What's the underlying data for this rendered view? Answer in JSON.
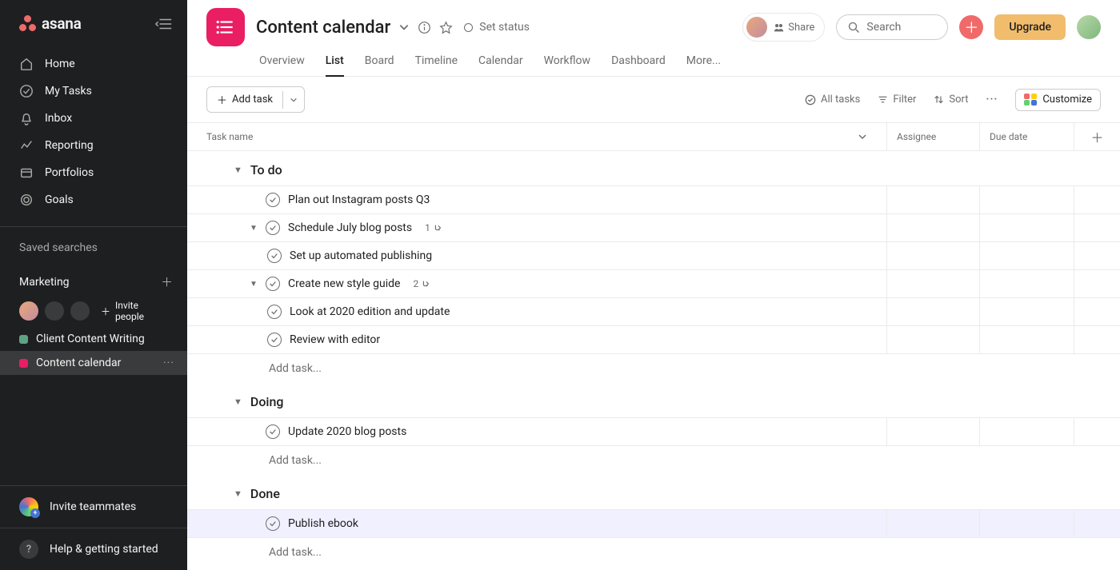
{
  "brand": "asana",
  "sidebar": {
    "nav": [
      {
        "icon": "home",
        "label": "Home"
      },
      {
        "icon": "check",
        "label": "My Tasks"
      },
      {
        "icon": "bell",
        "label": "Inbox"
      },
      {
        "icon": "chart",
        "label": "Reporting"
      },
      {
        "icon": "folder",
        "label": "Portfolios"
      },
      {
        "icon": "target",
        "label": "Goals"
      }
    ],
    "saved_searches_label": "Saved searches",
    "team_name": "Marketing",
    "invite_label": "Invite people",
    "projects": [
      {
        "name": "Client Content Writing",
        "color": "#5da283",
        "active": false
      },
      {
        "name": "Content calendar",
        "color": "#e91e63",
        "active": true
      }
    ],
    "invite_teammates": "Invite teammates",
    "help": "Help & getting started"
  },
  "header": {
    "title": "Content calendar",
    "set_status": "Set status",
    "share": "Share",
    "search_placeholder": "Search",
    "upgrade": "Upgrade"
  },
  "tabs": [
    "Overview",
    "List",
    "Board",
    "Timeline",
    "Calendar",
    "Workflow",
    "Dashboard",
    "More..."
  ],
  "active_tab": "List",
  "toolbar": {
    "add_task": "Add task",
    "all_tasks": "All tasks",
    "filter": "Filter",
    "sort": "Sort",
    "customize": "Customize"
  },
  "columns": {
    "task": "Task name",
    "assignee": "Assignee",
    "due": "Due date"
  },
  "add_task_placeholder": "Add task...",
  "sections": [
    {
      "name": "To do",
      "tasks": [
        {
          "title": "Plan out Instagram posts Q3"
        },
        {
          "title": "Schedule July blog posts",
          "subcount": "1",
          "expanded": true,
          "subtasks": [
            {
              "title": "Set up automated publishing"
            }
          ]
        },
        {
          "title": "Create new style guide",
          "subcount": "2",
          "expanded": true,
          "subtasks": [
            {
              "title": "Look at 2020 edition and update"
            },
            {
              "title": "Review with editor"
            }
          ]
        }
      ],
      "show_add": true
    },
    {
      "name": "Doing",
      "tasks": [
        {
          "title": "Update 2020 blog posts"
        }
      ],
      "show_add": true
    },
    {
      "name": "Done",
      "tasks": [
        {
          "title": "Publish ebook",
          "highlight": true
        }
      ],
      "show_add": true
    }
  ]
}
